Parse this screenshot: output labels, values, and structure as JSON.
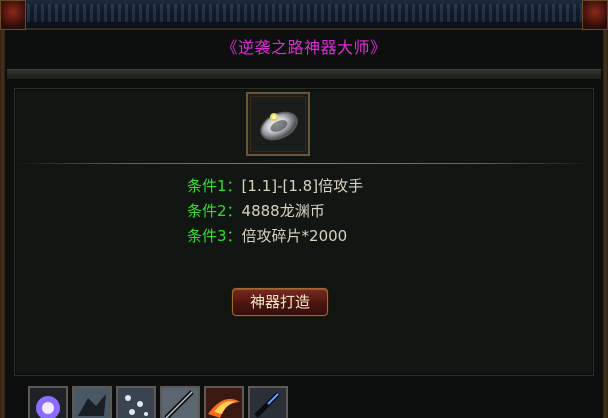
{
  "window": {
    "title": "《逆袭之路神器大师》"
  },
  "item": {
    "icon": "silver-ring-icon"
  },
  "conditions": [
    {
      "label": "条件1：",
      "value": "[1.1]-[1.8]倍攻手"
    },
    {
      "label": "条件2：",
      "value": "4888龙渊币"
    },
    {
      "label": "条件3：",
      "value": "倍攻碎片*2000"
    }
  ],
  "actions": {
    "forge_label": "神器打造"
  },
  "skillbar": {
    "skills": [
      "purple-orb-skill-icon",
      "shadow-beast-skill-icon",
      "scatter-skill-icon",
      "sword-skill-icon",
      "fire-slash-skill-icon",
      "blade-skill-icon"
    ]
  },
  "colors": {
    "title": "#e02ad8",
    "condition_label": "#33dd33",
    "condition_value": "#d9d2c0",
    "button_bg": "#5a1a12"
  }
}
